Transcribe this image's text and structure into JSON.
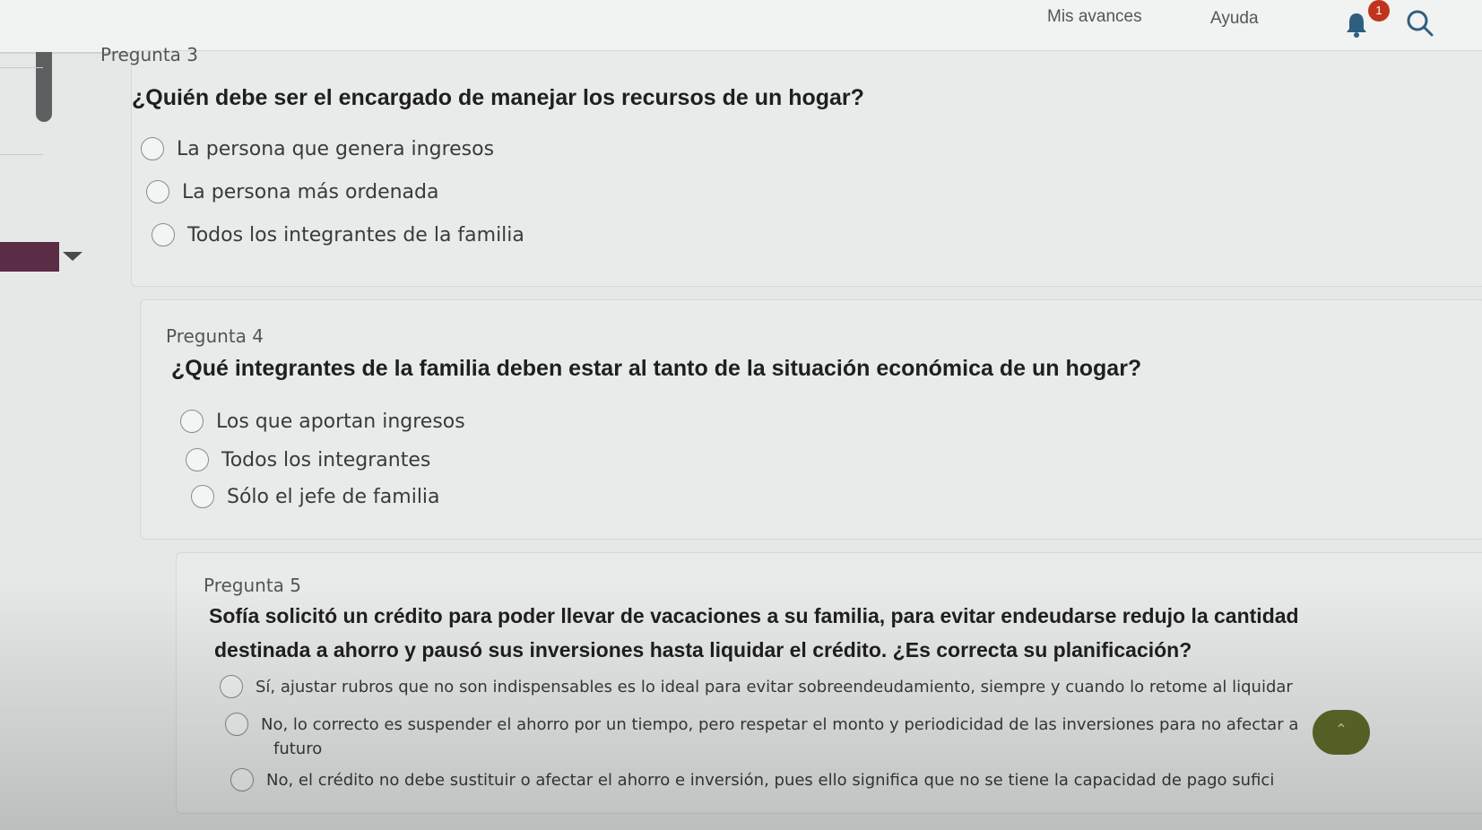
{
  "header": {
    "nav_progress": "Mis avances",
    "nav_help": "Ayuda",
    "notification_count": "1",
    "icons": [
      "bell-icon",
      "search-icon"
    ]
  },
  "q3": {
    "number_label": "Pregunta 3",
    "text": "¿Quién debe ser el encargado de manejar los recursos de un hogar?",
    "options": [
      "La persona que genera ingresos",
      "La persona más ordenada",
      "Todos los integrantes de la familia"
    ]
  },
  "q4": {
    "number_label": "Pregunta 4",
    "text": "¿Qué integrantes de la familia deben estar al tanto de la situación económica de un hogar?",
    "options": [
      "Los que aportan ingresos",
      "Todos los integrantes",
      "Sólo el jefe de familia"
    ]
  },
  "q5": {
    "number_label": "Pregunta 5",
    "text_line1": "Sofía solicitó un crédito para poder llevar de vacaciones a su familia, para evitar endeudarse redujo la cantidad",
    "text_line2": "destinada a ahorro y pausó sus inversiones hasta liquidar el crédito. ¿Es correcta su planificación?",
    "options": [
      "Sí, ajustar rubros que no son indispensables es lo ideal para evitar sobreendeudamiento, siempre y cuando lo retome al liquidar",
      "No, lo correcto es suspender el ahorro por un tiempo, pero respetar el monto y periodicidad de las inversiones para no afectar a",
      "No, el crédito no debe sustituir o afectar el ahorro e inversión, pues ello significa que no se tiene la capacidad de pago sufici"
    ],
    "option2_line2": "futuro"
  },
  "colors": {
    "accent": "#5a2c45",
    "badge": "#c0341d",
    "fab": "#5f6b2a"
  }
}
